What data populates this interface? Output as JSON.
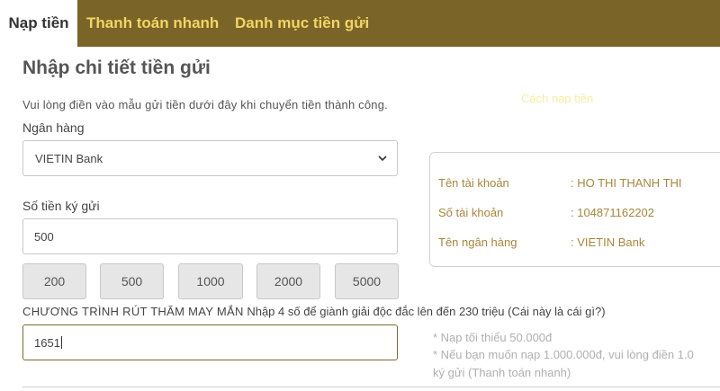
{
  "tabs": [
    {
      "label": "Nạp tiền",
      "active": true
    },
    {
      "label": "Thanh toán nhanh",
      "active": false
    },
    {
      "label": "Danh mục tiền gửi",
      "active": false
    }
  ],
  "form": {
    "title": "Nhập chi tiết tiền gửi",
    "how_to_link": "Cách nạp tiền",
    "instruction": "Vui lòng điền vào mẫu gửi tiền dưới đây khi chuyển tiền thành công.",
    "bank_label": "Ngân hàng",
    "bank_selected": "VIETIN Bank",
    "amount_label": "Số tiền ký gửi",
    "amount_value": "500",
    "quick_amounts": [
      "200",
      "500",
      "1000",
      "2000",
      "5000"
    ],
    "lucky_title": "CHƯƠNG TRÌNH RÚT THĂM MAY MẮN",
    "lucky_desc": "Nhập 4 số để giành giải độc đắc lên đến 230 triệu (Cái này là cái gì?)",
    "lucky_value": "1651"
  },
  "account_info": {
    "rows": [
      {
        "label": "Tên tài khoản",
        "value": ": HO THI THANH THI"
      },
      {
        "label": "Số tài khoản",
        "value": ": 104871162202"
      },
      {
        "label": "Tên ngân hàng",
        "value": ": VIETIN Bank"
      }
    ]
  },
  "notes": [
    "* Nạp tối thiểu 50.000đ",
    "* Nếu bạn muốn nạp 1.000.000đ, vui lòng điền 1.0",
    "ký gửi (Thanh toán nhanh)"
  ],
  "colors": {
    "tab_bar": "#7a6428",
    "tab_text": "#f2d564",
    "info_text": "#a8863c"
  }
}
